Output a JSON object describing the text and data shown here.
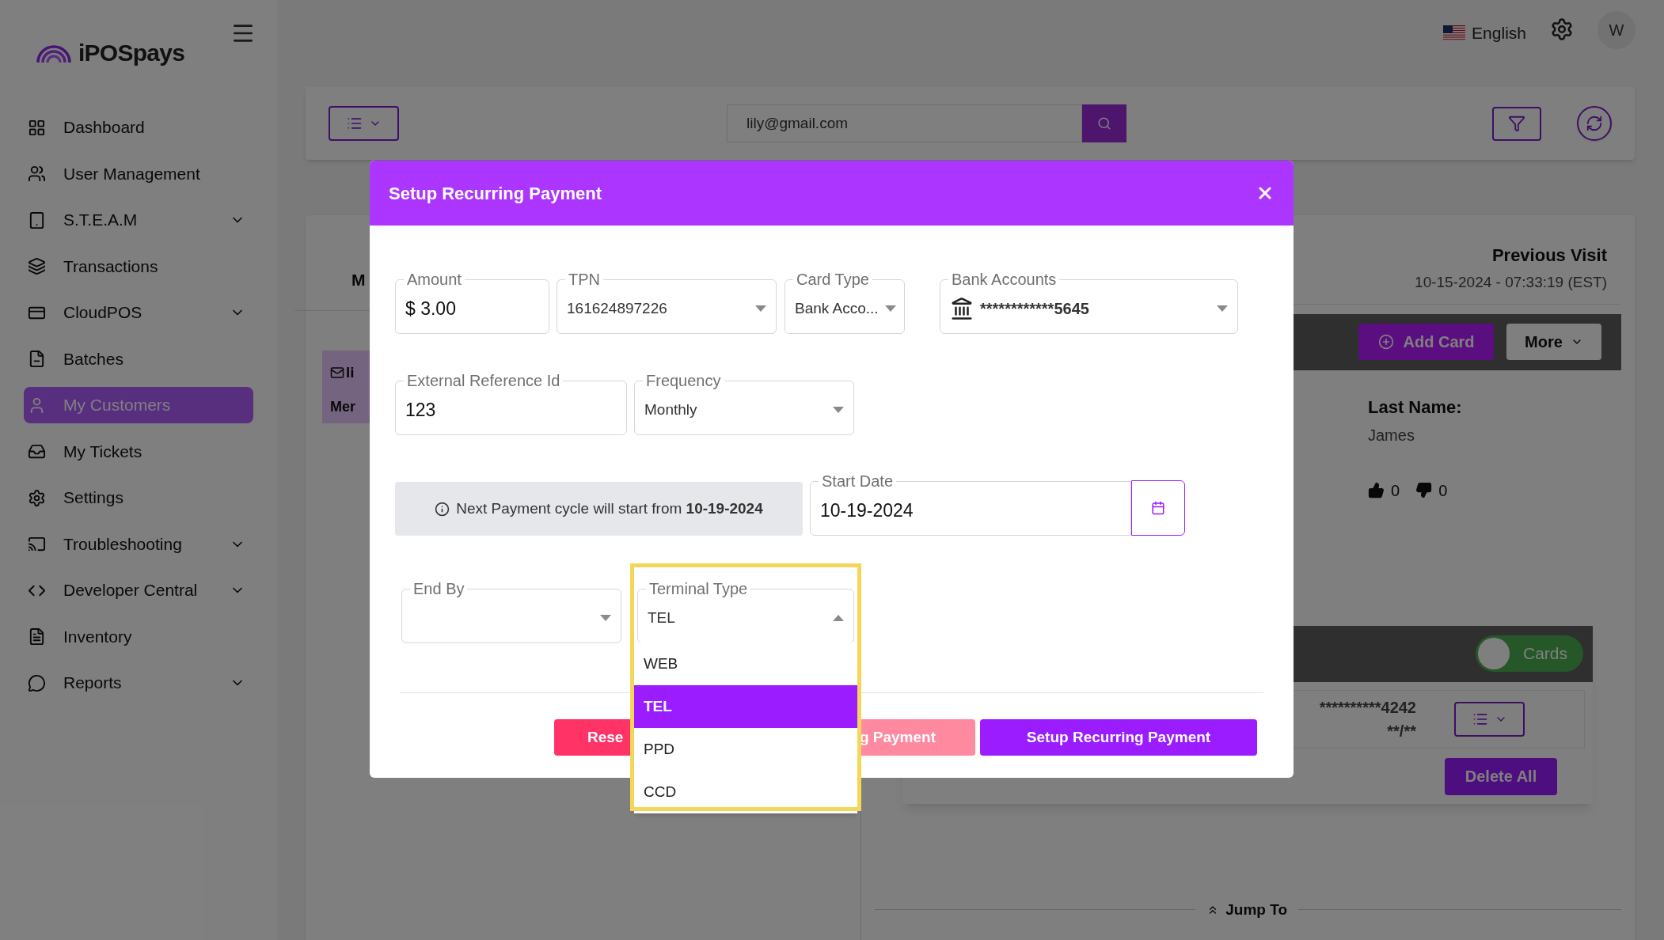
{
  "app": {
    "logo": "iPOSpays"
  },
  "sidebar": {
    "items": [
      {
        "label": "Dashboard",
        "has_submenu": false,
        "selected": false
      },
      {
        "label": "User Management",
        "has_submenu": false,
        "selected": false
      },
      {
        "label": "S.T.E.A.M",
        "has_submenu": true,
        "selected": false
      },
      {
        "label": "Transactions",
        "has_submenu": false,
        "selected": false
      },
      {
        "label": "CloudPOS",
        "has_submenu": true,
        "selected": false
      },
      {
        "label": "Batches",
        "has_submenu": false,
        "selected": false
      },
      {
        "label": "My Customers",
        "has_submenu": false,
        "selected": true
      },
      {
        "label": "My Tickets",
        "has_submenu": false,
        "selected": false
      },
      {
        "label": "Settings",
        "has_submenu": false,
        "selected": false
      },
      {
        "label": "Troubleshooting",
        "has_submenu": true,
        "selected": false
      },
      {
        "label": "Developer Central",
        "has_submenu": true,
        "selected": false
      },
      {
        "label": "Inventory",
        "has_submenu": false,
        "selected": false
      },
      {
        "label": "Reports",
        "has_submenu": true,
        "selected": false
      }
    ]
  },
  "header": {
    "language": "English",
    "avatar": "W"
  },
  "toolbar": {
    "search_value": "lily@gmail.com"
  },
  "background": {
    "fragments": [
      "M",
      "li",
      "Mer"
    ],
    "previous_visit_label": "Previous Visit",
    "previous_visit": "10-15-2024 - 07:33:19 (EST)",
    "add_card": "Add Card",
    "more": "More",
    "last_name_label": "Last Name:",
    "last_name": "James",
    "likes": "0",
    "dislikes": "0",
    "cards_toggle": {
      "label": "Cards",
      "on": true
    },
    "card_number": "**********4242",
    "card_expiry": "**/**",
    "delete_all": "Delete All",
    "jump_to": "Jump To"
  },
  "modal": {
    "title": "Setup Recurring Payment",
    "rows": [
      {
        "fields": [
          {
            "kind": "text",
            "label": "Amount",
            "value": "$ 3.00"
          },
          {
            "kind": "select",
            "label": "TPN",
            "value": "161624897226"
          },
          {
            "kind": "select",
            "label": "Card Type",
            "value": "Bank Acco..."
          },
          {
            "kind": "bank",
            "label": "Bank Accounts",
            "value": "************5645"
          }
        ]
      },
      {
        "fields": [
          {
            "kind": "text",
            "label": "External Reference Id",
            "value": "123"
          },
          {
            "kind": "select",
            "label": "Frequency",
            "value": "Monthly"
          }
        ]
      },
      {
        "fields": [
          {
            "kind": "info",
            "text": "Next Payment cycle will start from **10-19-2024**"
          },
          {
            "kind": "date",
            "label": "Start Date",
            "value": "10-19-2024"
          }
        ]
      },
      {
        "fields": [
          {
            "kind": "select",
            "label": "End By"
          },
          {
            "kind": "select",
            "label": "Terminal Type",
            "value": "TEL",
            "open": true,
            "options": [
              {
                "label": "WEB",
                "selected": false
              },
              {
                "label": "TEL",
                "selected": true
              },
              {
                "label": "PPD",
                "selected": false
              },
              {
                "label": "CCD",
                "selected": false
              }
            ]
          }
        ]
      }
    ],
    "buttons": [
      {
        "kind": "reset",
        "label": "Rese"
      },
      {
        "kind": "secondary",
        "label": "g Payment"
      },
      {
        "kind": "primary",
        "label": "Setup Recurring Payment"
      }
    ]
  }
}
